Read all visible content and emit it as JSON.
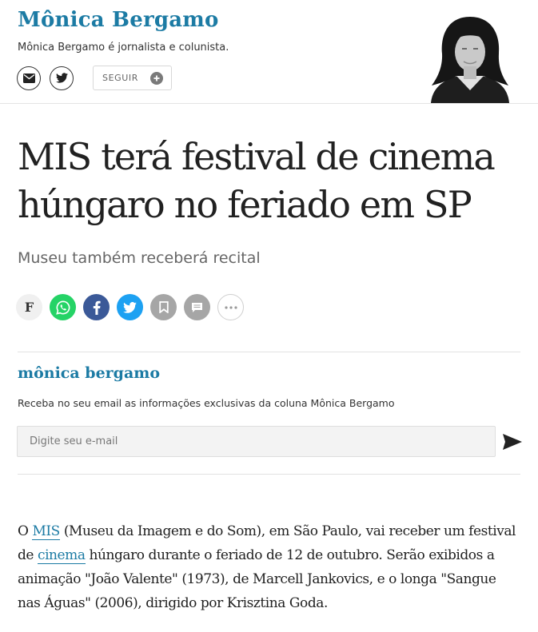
{
  "column": {
    "name": "Mônica Bergamo",
    "description": "Mônica Bergamo é jornalista e colunista.",
    "follow_label": "SEGUIR"
  },
  "article": {
    "headline": "MIS terá festival de cinema húngaro no feriado em SP",
    "subheadline": "Museu também receberá recital",
    "body": {
      "p1": "O ",
      "link1": "MIS",
      "p2": " (Museu da Imagem e do Som), em São Paulo, vai receber um festival de ",
      "link2": "cinema",
      "p3": " húngaro durante o feriado de 12 de outubro. Serão exibidos a animação \"João Valente\" (1973), de Marcell Jankovics, e o longa \"Sangue nas Águas\" (2006), dirigido por Krisztina Goda."
    }
  },
  "share": {
    "folha_letter": "F",
    "icons": [
      "folha-icon",
      "whatsapp-icon",
      "facebook-icon",
      "twitter-icon",
      "bookmark-icon",
      "comment-icon",
      "more-icon"
    ]
  },
  "newsletter": {
    "title": "mônica bergamo",
    "description": "Receba no seu email as informações exclusivas da coluna Mônica Bergamo",
    "placeholder": "Digite seu e-mail"
  },
  "colors": {
    "accent": "#1c7ba4",
    "whatsapp": "#25d366",
    "facebook": "#3b5998",
    "twitter": "#1da1f2",
    "muted_button": "#a6a6a6"
  }
}
